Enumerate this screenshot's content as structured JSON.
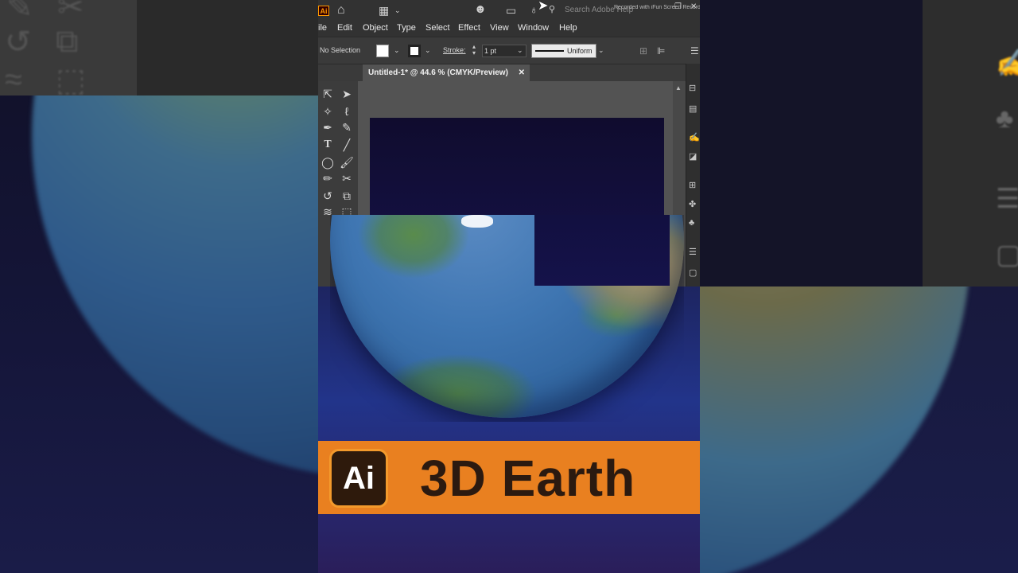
{
  "app": {
    "logo": "Ai",
    "search_placeholder": "Search Adobe Help",
    "watermark": "Recorded with iFun Screen Recorder"
  },
  "menu": [
    "File",
    "Edit",
    "Object",
    "Type",
    "Select",
    "Effect",
    "View",
    "Window",
    "Help"
  ],
  "menu_display": [
    "ile",
    "Edit",
    "Object",
    "Type",
    "Select",
    "Effect",
    "View",
    "Window",
    "Help"
  ],
  "control": {
    "selection": "No Selection",
    "stroke_label": "Stroke:",
    "stroke_value": "1 pt",
    "profile": "Uniform"
  },
  "document": {
    "tab_title": "Untitled-1* @ 44.6 % (CMYK/Preview)"
  },
  "banner": {
    "badge": "Ai",
    "title": "3D Earth"
  },
  "colors": {
    "banner": "#e98020",
    "badge_bg": "#2e1a0c",
    "ui_dark": "#323232",
    "artboard": "#15124a"
  }
}
